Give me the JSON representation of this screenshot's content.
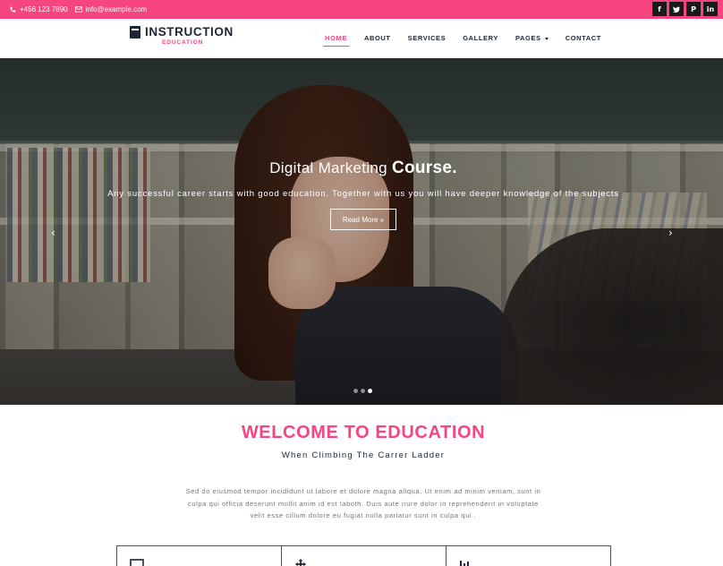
{
  "topbar": {
    "phone": "+456 123 7890",
    "email": "info@example.com",
    "social": [
      {
        "icon": "facebook-icon",
        "glyph": "f"
      },
      {
        "icon": "twitter-icon",
        "glyph": "t"
      },
      {
        "icon": "pinterest-icon",
        "glyph": "P"
      },
      {
        "icon": "linkedin-icon",
        "glyph": "in"
      }
    ]
  },
  "brand": {
    "name": "INSTRUCTION",
    "tagline": "EDUCATION"
  },
  "nav": {
    "items": [
      "HOME",
      "ABOUT",
      "SERVICES",
      "GALLERY",
      "PAGES",
      "CONTACT"
    ],
    "active": "HOME"
  },
  "hero": {
    "title_light": "Digital Marketing",
    "title_bold": "Course.",
    "text": "Any successful career starts with good education. Together with us you will have deeper knowledge of the subjects",
    "button": "Read More »",
    "prev": "‹",
    "next": "›",
    "slides": 3,
    "active_slide": 3
  },
  "welcome": {
    "title": "WELCOME TO EDUCATION",
    "subtitle": "When Climbing The Carrer Ladder",
    "paragraph_lines": [
      "Sed do eiusmod tempor incididunt ut labore et dolore magna aliqua. Ut enim ad minim veniam, sunt in",
      "culpa qui officia deserunt mollit anim id est laboth. Duis aute irure dolor in reprehenderit in voluptate",
      "velit esse cillum dolore eu fugiat nulla pariatur sunt in culpa qui ."
    ]
  },
  "features": {
    "icons": [
      "monitor-icon",
      "move-icon",
      "bar-chart-icon"
    ]
  },
  "colors": {
    "accent": "#f7467f",
    "dark": "#1d2636",
    "social_bg": "#1a1a1a"
  }
}
